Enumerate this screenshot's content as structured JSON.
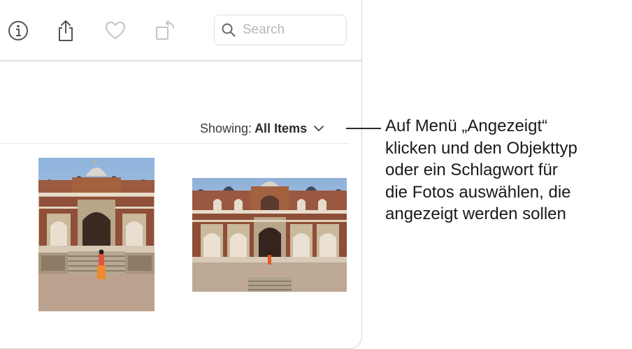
{
  "toolbar": {
    "info_icon": "info-circle-icon",
    "share_icon": "share-icon",
    "favorite_icon": "heart-icon",
    "rotate_icon": "rotate-icon",
    "search": {
      "placeholder": "Search",
      "value": ""
    }
  },
  "filter": {
    "label": "Showing:",
    "value": "All Items",
    "icon": "chevron-down-icon"
  },
  "callout": {
    "lines": [
      "Auf Menü „Angezeigt“",
      "klicken und den Objekttyp",
      "oder ein Schlagwort für",
      "die Fotos auswählen, die",
      "angezeigt werden sollen"
    ]
  },
  "photos": [
    {
      "name": "portrait-photo",
      "subject": "tomb-with-person"
    },
    {
      "name": "landscape-photo",
      "subject": "tomb-wide"
    }
  ]
}
